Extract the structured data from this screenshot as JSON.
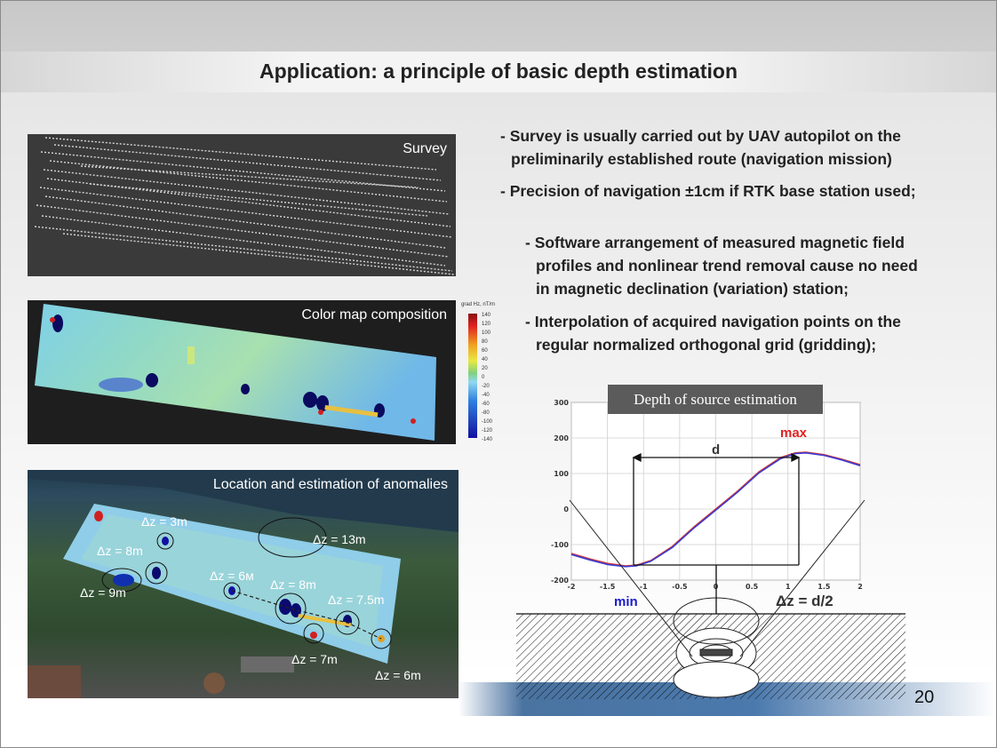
{
  "slide": {
    "title": "Application: a principle of basic depth estimation",
    "page_number": "20"
  },
  "panels": {
    "survey_label": "Survey",
    "colormap_label": "Color map composition",
    "anomalies_label": "Location and estimation of anomalies"
  },
  "colorbar": {
    "title": "grad Hz, nT/m",
    "ticks": [
      "140",
      "120",
      "100",
      "80",
      "60",
      "40",
      "20",
      "0",
      "-20",
      "-40",
      "-60",
      "-80",
      "-100",
      "-120",
      "-140"
    ]
  },
  "anomaly_labels": [
    "Δz = 3m",
    "Δz = 8m",
    "Δz = 9m",
    "Δz = 6м",
    "Δz = 8m",
    "Δz = 7.5m",
    "Δz = 13m",
    "Δz = 7m",
    "Δz = 6m"
  ],
  "bullets": [
    {
      "line1": "- Survey is usually carried out by UAV autopilot on the",
      "line2": "preliminarily established route (navigation mission)"
    },
    {
      "line1": "- Precision of navigation ±1cm if RTK base station used;"
    },
    {
      "line1": "- Software arrangement of measured magnetic field",
      "line2": "profiles and nonlinear trend removal cause no need",
      "line3": "in magnetic declination (variation) station;"
    },
    {
      "line1": "- Interpolation of acquired navigation points on the",
      "line2": "regular normalized orthogonal grid (gridding);"
    }
  ],
  "depth_panel": {
    "title": "Depth of source estimation",
    "label_max": "max",
    "label_min": "min",
    "label_d": "d",
    "label_dz": "Δz = d/2",
    "colors": {
      "max": "#e02020",
      "min": "#1a1ad0",
      "dz": "#333333"
    }
  },
  "chart_data": {
    "type": "line",
    "x_ticks": [
      "-2",
      "-1.5",
      "-1",
      "-0.5",
      "0",
      "0.5",
      "1",
      "1.5",
      "2"
    ],
    "y_ticks": [
      "300",
      "200",
      "100",
      "0",
      "-100",
      "-200"
    ],
    "xlim": [
      -2,
      2
    ],
    "ylim": [
      -200,
      300
    ],
    "series": [
      {
        "color": "#d23a3a",
        "x": [
          -2,
          -1.75,
          -1.5,
          -1.25,
          -1.1,
          -0.9,
          -0.6,
          -0.3,
          0,
          0.3,
          0.6,
          0.9,
          1.1,
          1.25,
          1.5,
          1.75,
          2
        ],
        "y": [
          -125,
          -140,
          -153,
          -160,
          -158,
          -145,
          -105,
          -50,
          0,
          50,
          105,
          145,
          158,
          160,
          153,
          140,
          125
        ]
      },
      {
        "color": "#3a3ad2",
        "x": [
          -2,
          -1.75,
          -1.5,
          -1.25,
          -1.1,
          -0.9,
          -0.6,
          -0.3,
          0,
          0.3,
          0.6,
          0.9,
          1.1,
          1.25,
          1.5,
          1.75,
          2
        ],
        "y": [
          -128,
          -143,
          -156,
          -162,
          -160,
          -147,
          -108,
          -53,
          -3,
          47,
          102,
          142,
          156,
          158,
          151,
          138,
          122
        ]
      }
    ],
    "grid": true
  }
}
